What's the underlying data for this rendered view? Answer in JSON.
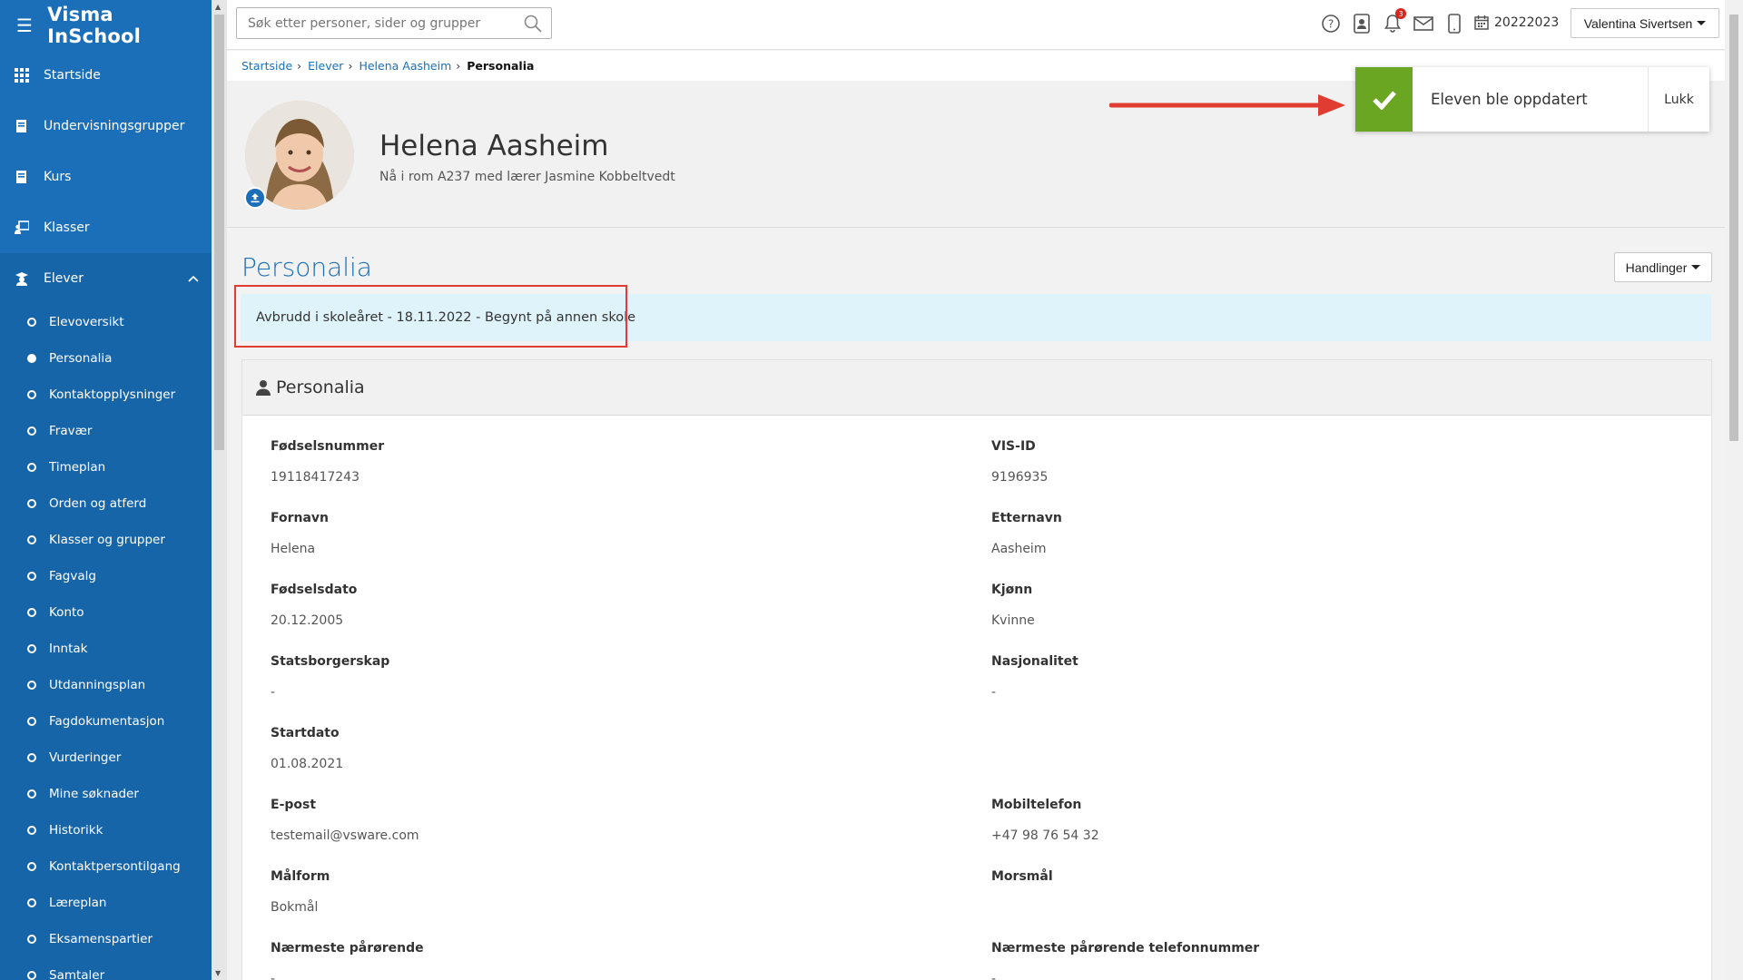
{
  "app": {
    "title": "Visma InSchool"
  },
  "sidebar": {
    "main_items": [
      {
        "label": "Startside",
        "icon": "grid-icon"
      },
      {
        "label": "Undervisningsgrupper",
        "icon": "book-icon"
      },
      {
        "label": "Kurs",
        "icon": "book-icon"
      },
      {
        "label": "Klasser",
        "icon": "classroom-icon"
      },
      {
        "label": "Elever",
        "icon": "student-icon"
      }
    ],
    "sub_items": [
      {
        "label": "Elevoversikt",
        "active": false
      },
      {
        "label": "Personalia",
        "active": true
      },
      {
        "label": "Kontaktopplysninger",
        "active": false
      },
      {
        "label": "Fravær",
        "active": false
      },
      {
        "label": "Timeplan",
        "active": false
      },
      {
        "label": "Orden og atferd",
        "active": false
      },
      {
        "label": "Klasser og grupper",
        "active": false
      },
      {
        "label": "Fagvalg",
        "active": false
      },
      {
        "label": "Konto",
        "active": false
      },
      {
        "label": "Inntak",
        "active": false
      },
      {
        "label": "Utdanningsplan",
        "active": false
      },
      {
        "label": "Fagdokumentasjon",
        "active": false
      },
      {
        "label": "Vurderinger",
        "active": false
      },
      {
        "label": "Mine søknader",
        "active": false
      },
      {
        "label": "Historikk",
        "active": false
      },
      {
        "label": "Kontaktpersontilgang",
        "active": false
      },
      {
        "label": "Læreplan",
        "active": false
      },
      {
        "label": "Eksamenspartier",
        "active": false
      },
      {
        "label": "Samtaler",
        "active": false
      }
    ]
  },
  "topbar": {
    "search_placeholder": "Søk etter personer, sider og grupper",
    "notification_count": "3",
    "school_year": "20222023",
    "user_name": "Valentina Sivertsen"
  },
  "breadcrumb": {
    "items": [
      "Startside",
      "Elever",
      "Helena Aasheim"
    ],
    "current": "Personalia"
  },
  "profile": {
    "name": "Helena Aasheim",
    "subtitle": "Nå i rom A237 med lærer Jasmine Kobbeltvedt"
  },
  "toast": {
    "message": "Eleven ble oppdatert",
    "close_label": "Lukk"
  },
  "page": {
    "title": "Personalia",
    "actions_label": "Handlinger",
    "notice": "Avbrudd i skoleåret - 18.11.2022 - Begynt på annen skole"
  },
  "panel": {
    "title": "Personalia",
    "fields": [
      {
        "label": "Fødselsnummer",
        "value": "19118417243"
      },
      {
        "label": "VIS-ID",
        "value": "9196935"
      },
      {
        "label": "Fornavn",
        "value": "Helena"
      },
      {
        "label": "Etternavn",
        "value": "Aasheim"
      },
      {
        "label": "Fødselsdato",
        "value": "20.12.2005"
      },
      {
        "label": "Kjønn",
        "value": "Kvinne"
      },
      {
        "label": "Statsborgerskap",
        "value": "-"
      },
      {
        "label": "Nasjonalitet",
        "value": "-"
      },
      {
        "label": "Startdato",
        "value": "01.08.2021"
      },
      {
        "label": "E-post",
        "value": "testemail@vsware.com"
      },
      {
        "label": "Mobiltelefon",
        "value": "+47 98 76 54 32"
      },
      {
        "label": "Målform",
        "value": "Bokmål"
      },
      {
        "label": "Morsmål",
        "value": ""
      },
      {
        "label": "Nærmeste pårørende",
        "value": "-"
      },
      {
        "label": "Nærmeste pårørende telefonnummer",
        "value": "-"
      }
    ]
  },
  "colors": {
    "sidebar": "#1b6fb8",
    "accent": "#1b6fb8",
    "success": "#6aa621",
    "notice_bg": "#dff3fb",
    "highlight": "#e03c31"
  }
}
